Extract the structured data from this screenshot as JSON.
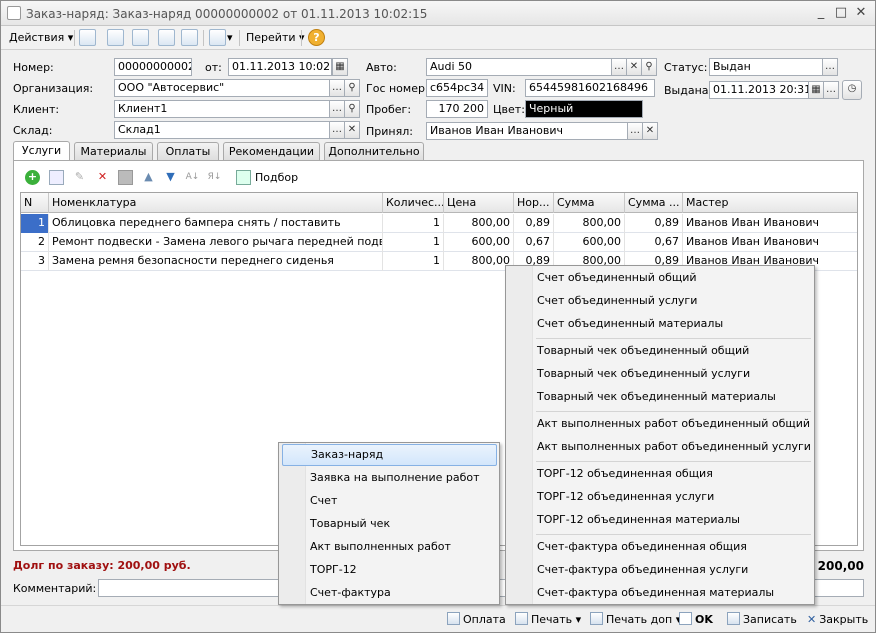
{
  "window": {
    "title": "Заказ-наряд: Заказ-наряд 00000000002 от 01.11.2013 10:02:15"
  },
  "toolbar": {
    "actions": "Действия",
    "goto": "Перейти"
  },
  "form": {
    "number_label": "Номер:",
    "number": "00000000002",
    "from_label": "от:",
    "date": "01.11.2013 10:02:15",
    "org_label": "Организация:",
    "org": "ООО \"Автосервис\"",
    "client_label": "Клиент:",
    "client": "Клиент1",
    "warehouse_label": "Склад:",
    "warehouse": "Склад1",
    "auto_label": "Авто:",
    "auto": "Audi 50",
    "plate_label": "Гос номер:",
    "plate": "с654рс34",
    "vin_label": "VIN:",
    "vin": "65445981602168496",
    "mileage_label": "Пробег:",
    "mileage": "170 200",
    "color_label": "Цвет:",
    "color": "Черный",
    "accepted_label": "Принял:",
    "accepted": "Иванов Иван Иванович",
    "status_label": "Статус:",
    "status": "Выдан",
    "issued_label": "Выдана:",
    "issued": "01.11.2013 20:31"
  },
  "tabs": [
    "Услуги",
    "Материалы",
    "Оплаты",
    "Рекомендации",
    "Дополнительно"
  ],
  "panel": {
    "pick_label": "Подбор"
  },
  "table": {
    "headers": [
      "N",
      "Номенклатура",
      "Количес...",
      "Цена",
      "Нор...",
      "Сумма",
      "Сумма ...",
      "Мастер"
    ],
    "rows": [
      [
        "1",
        "Облицовка переднего бампера снять / поставить",
        "1",
        "800,00",
        "0,89",
        "800,00",
        "0,89",
        "Иванов Иван Иванович"
      ],
      [
        "2",
        "Ремонт подвески - Замена левого рычага передней подвески",
        "1",
        "600,00",
        "0,67",
        "600,00",
        "0,67",
        "Иванов Иван Иванович"
      ],
      [
        "3",
        "Замена ремня безопасности переднего сиденья",
        "1",
        "800,00",
        "0,89",
        "800,00",
        "0,89",
        "Иванов Иван Иванович"
      ]
    ]
  },
  "footer": {
    "debt": "Долг по заказу: 200,00 руб.",
    "total": "3 200,00",
    "comment_label": "Комментарий:"
  },
  "bottom": {
    "payment": "Оплата",
    "print": "Печать",
    "print_extra": "Печать доп",
    "ok": "OK",
    "save": "Записать",
    "close": "Закрыть"
  },
  "print_menu": [
    "Заказ-наряд",
    "Заявка на выполнение работ",
    "Счет",
    "Товарный чек",
    "Акт выполненных работ",
    "ТОРГ-12",
    "Счет-фактура"
  ],
  "print_extra_menu": [
    [
      "Счет объединенный общий",
      "Счет объединенный услуги",
      "Счет объединенный материалы"
    ],
    [
      "Товарный чек объединенный общий",
      "Товарный чек объединенный услуги",
      "Товарный чек объединенный материалы"
    ],
    [
      "Акт выполненных работ объединенный общий",
      "Акт выполненных работ объединенный услуги"
    ],
    [
      "ТОРГ-12  объединенная общия",
      "ТОРГ-12  объединенная услуги",
      "ТОРГ-12  объединенная материалы"
    ],
    [
      "Счет-фактура объединенная общия",
      "Счет-фактура объединенная услуги",
      "Счет-фактура объединенная материалы"
    ]
  ],
  "colors": {
    "selected_row": "#3b6ec8",
    "debt_text": "#a01010",
    "menu_highlight": "#d3e6fb"
  }
}
